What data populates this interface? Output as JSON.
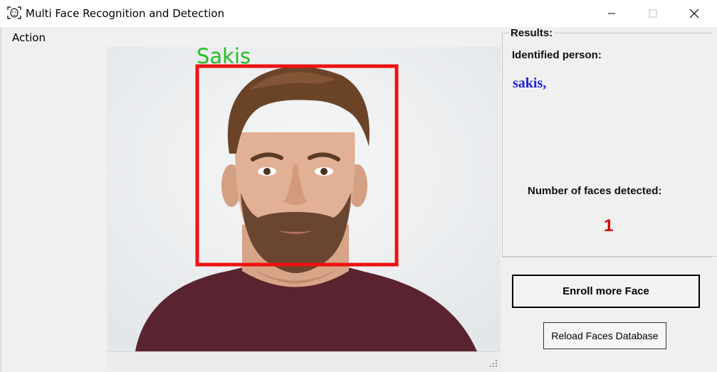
{
  "window": {
    "title": "Multi Face Recognition and Detection",
    "icon": "face-scan-icon"
  },
  "menu": {
    "items": [
      {
        "label": "Action"
      }
    ]
  },
  "picture": {
    "face_label": "Sakis",
    "face_label_color": "#22c022",
    "box_color": "#ee1111"
  },
  "results": {
    "legend": "Results:",
    "identified_label": "Identified person:",
    "identified_value": "sakis,",
    "count_label": "Number of faces detected:",
    "count_value": "1"
  },
  "buttons": {
    "enroll_label": "Enroll more Face",
    "reload_label": "Reload Faces Database"
  },
  "colors": {
    "identified_text": "#2020e0",
    "count_text": "#e00000"
  }
}
